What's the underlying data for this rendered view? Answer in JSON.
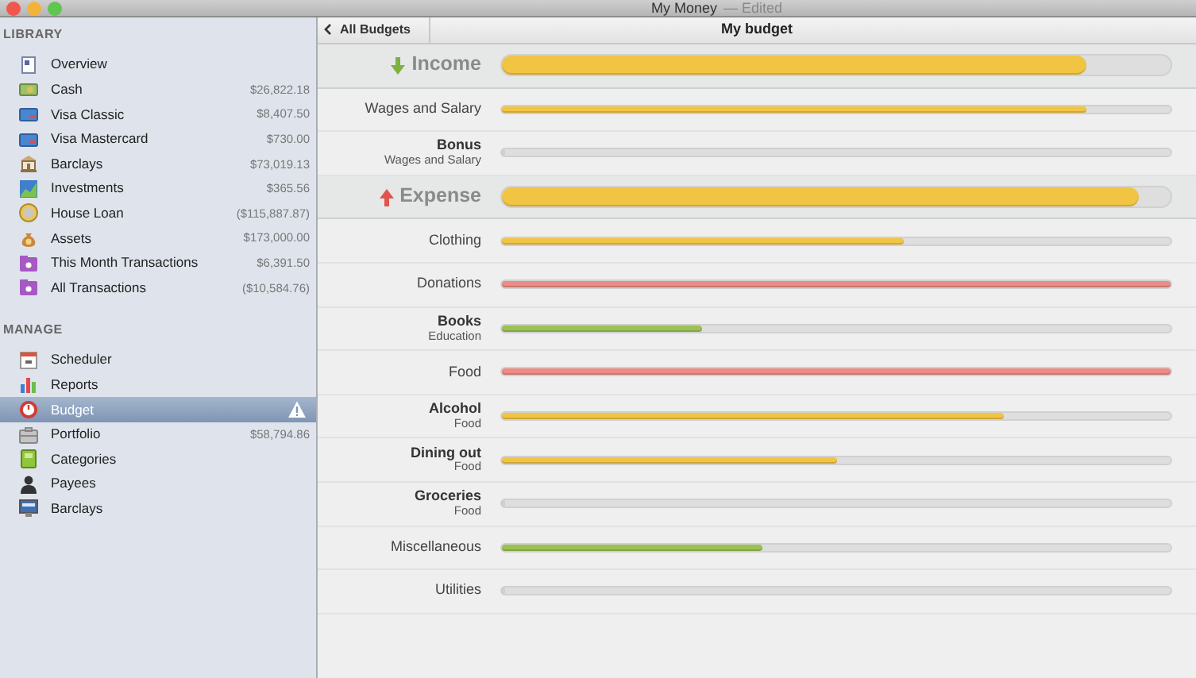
{
  "window": {
    "title": "My Money",
    "subtitle": "— Edited"
  },
  "sidebar": {
    "sections": [
      {
        "title": "LIBRARY",
        "items": [
          {
            "label": "Overview",
            "kind": "overview",
            "selected": false,
            "alert": false
          },
          {
            "label": "Cash",
            "kind": "cash",
            "amount": "$26,822.18",
            "selected": false,
            "alert": false
          },
          {
            "label": "Visa Classic",
            "kind": "card",
            "amount": "$8,407.50",
            "selected": false,
            "alert": false
          },
          {
            "label": "Visa Mastercard",
            "kind": "card",
            "amount": "$730.00",
            "selected": false,
            "alert": false
          },
          {
            "label": "Barclays",
            "kind": "bank",
            "amount": "$73,019.13",
            "selected": false,
            "alert": false
          },
          {
            "label": "Investments",
            "kind": "investment",
            "amount": "$365.56",
            "selected": false,
            "alert": false
          },
          {
            "label": "House Loan",
            "kind": "loan",
            "amount": "($115,887.87)",
            "selected": false,
            "alert": false
          },
          {
            "label": "Assets",
            "kind": "assets",
            "amount": "$173,000.00",
            "selected": false,
            "alert": false
          },
          {
            "label": "This Month Transactions",
            "kind": "folder",
            "amount": "$6,391.50",
            "selected": false,
            "alert": false
          },
          {
            "label": "All Transactions",
            "kind": "folder",
            "amount": "($10,584.76)",
            "selected": false,
            "alert": false
          }
        ]
      },
      {
        "title": "MANAGE",
        "items": [
          {
            "label": "Scheduler",
            "kind": "calendar",
            "selected": false,
            "alert": false
          },
          {
            "label": "Reports",
            "kind": "chart",
            "selected": false,
            "alert": false
          },
          {
            "label": "Budget",
            "kind": "gauge",
            "selected": true,
            "alert": true
          },
          {
            "label": "Portfolio",
            "kind": "briefcase",
            "amount": "$58,794.86",
            "selected": false,
            "alert": false
          },
          {
            "label": "Categories",
            "kind": "book",
            "selected": false,
            "alert": false
          },
          {
            "label": "Payees",
            "kind": "person",
            "selected": false,
            "alert": false
          },
          {
            "label": "Barclays",
            "kind": "monitor",
            "selected": false,
            "alert": false
          }
        ]
      }
    ]
  },
  "header": {
    "back": "All Budgets",
    "title": "My budget"
  },
  "rows": [
    {
      "kind": "income",
      "label": "Income",
      "level": 0.875,
      "color": "#f2c443"
    },
    {
      "kind": "category",
      "label": "Wages and Salary",
      "level": 0.875,
      "color": "#f2c443"
    },
    {
      "kind": "category",
      "label": "Bonus",
      "parent": "Wages and Salary",
      "level": 0
    },
    {
      "kind": "expense",
      "label": "Expense",
      "level": 0.953,
      "color": "#f2c443"
    },
    {
      "kind": "category",
      "label": "Clothing",
      "level": 0.6,
      "color": "#f2c443"
    },
    {
      "kind": "category",
      "label": "Donations",
      "level": 1,
      "color": "#ec8b85"
    },
    {
      "kind": "category",
      "label": "Books",
      "parent": "Education",
      "level": 0.3,
      "color": "#9bc253"
    },
    {
      "kind": "category",
      "label": "Food",
      "level": 1,
      "color": "#ec8b85"
    },
    {
      "kind": "category",
      "label": "Alcohol",
      "parent": "Food",
      "level": 0.75,
      "color": "#f2c443"
    },
    {
      "kind": "category",
      "label": "Dining out",
      "parent": "Food",
      "level": 0.5,
      "color": "#f2c443"
    },
    {
      "kind": "category",
      "label": "Groceries",
      "parent": "Food",
      "level": 0
    },
    {
      "kind": "category",
      "label": "Miscellaneous",
      "level": 0.39,
      "color": "#9bc253"
    },
    {
      "kind": "category",
      "label": "Utilities",
      "level": 0
    }
  ]
}
